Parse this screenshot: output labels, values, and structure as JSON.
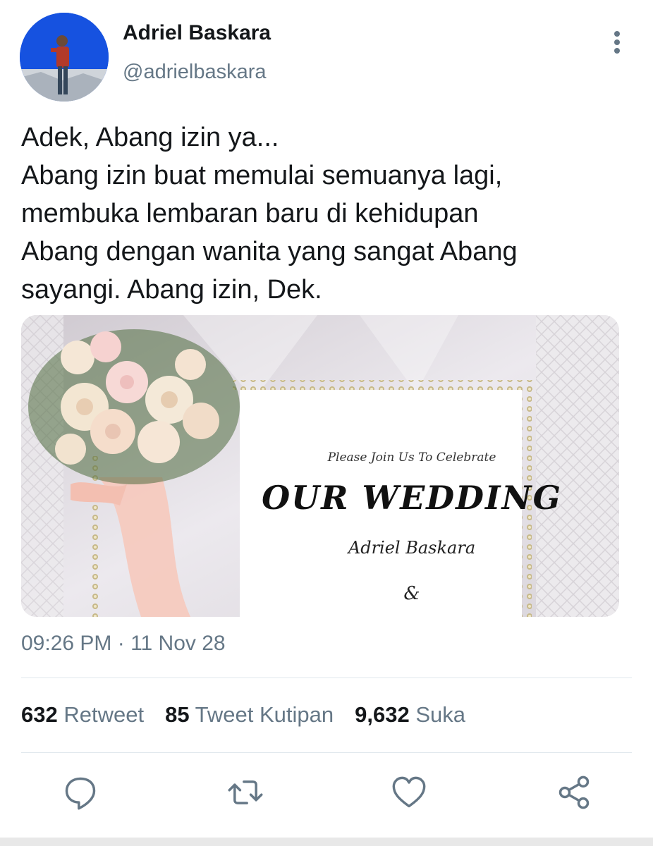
{
  "author": {
    "display_name": "Adriel Baskara",
    "handle": "@adrielbaskara"
  },
  "tweet": {
    "text": "Adek, Abang izin ya...\nAbang izin buat memulai semuanya lagi,\nmembuka lembaran baru di kehidupan\nAbang dengan wanita yang sangat Abang\nsayangi. Abang izin, Dek.",
    "timestamp": "09:26 PM · 11 Nov 28"
  },
  "media": {
    "invite_line": "Please Join Us To Celebrate",
    "headline": "OUR WEDDING",
    "name": "Adriel Baskara",
    "ampersand": "&"
  },
  "stats": {
    "retweets_count": "632",
    "retweets_label": "Retweet",
    "quotes_count": "85",
    "quotes_label": "Tweet Kutipan",
    "likes_count": "9,632",
    "likes_label": "Suka"
  },
  "colors": {
    "text": "#14171a",
    "secondary": "#657786",
    "divider": "#e1e8ed"
  },
  "icons": [
    "more-vertical-icon",
    "reply-icon",
    "retweet-icon",
    "like-icon",
    "share-icon"
  ]
}
